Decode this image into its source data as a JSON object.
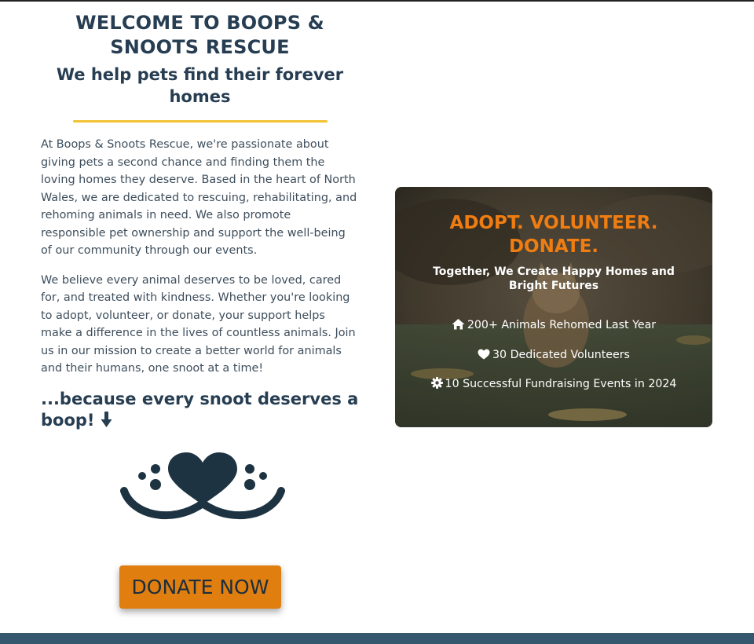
{
  "welcome": {
    "title": "WELCOME TO BOOPS & SNOOTS RESCUE",
    "subtitle": "We help pets find their forever homes"
  },
  "intro": {
    "paragraph_1": "At Boops & Snoots Rescue, we're passionate about giving pets a second chance and finding them the loving homes they deserve. Based in the heart of North Wales, we are dedicated to rescuing, rehabilitating, and rehoming animals in need. We also promote responsible pet ownership and support the well-being of our community through our events.",
    "paragraph_2": "We believe every animal deserves to be loved, cared for, and treated with kindness. Whether you're looking to adopt, volunteer, or donate, your support helps make a difference in the lives of countless animals. Join us in our mission to create a better world for animals and their humans, one snoot at a time!",
    "tagline": "...because every snoot deserves a boop!",
    "tagline_icon": "arrow-down-icon"
  },
  "logo": {
    "icon": "snoot-heart-logo"
  },
  "donate_button": {
    "label": "DONATE NOW"
  },
  "hero": {
    "title": "ADOPT. VOLUNTEER. DONATE.",
    "subtitle": "Together, We Create Happy Homes and Bright Futures",
    "stats": [
      {
        "icon": "house-icon",
        "text": "200+ Animals Rehomed Last Year"
      },
      {
        "icon": "heart-icon",
        "text": "30 Dedicated Volunteers"
      },
      {
        "icon": "gear-icon",
        "text": "10 Successful Fundraising Events in 2024"
      }
    ]
  },
  "colors": {
    "heading": "#263d52",
    "accent_orange": "#e07e10",
    "divider_yellow": "#f1c232",
    "footer": "#35586e"
  }
}
